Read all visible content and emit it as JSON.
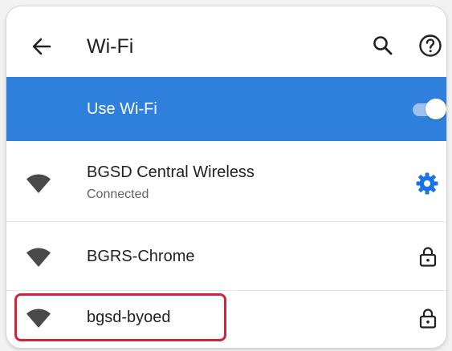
{
  "app_bar": {
    "title": "Wi-Fi",
    "icons": {
      "back": "arrow-back-icon",
      "search": "search-icon",
      "help": "help-circle-icon"
    }
  },
  "master_toggle": {
    "label": "Use Wi-Fi",
    "state": "on"
  },
  "networks": [
    {
      "ssid": "BGSD Central Wireless",
      "status": "Connected",
      "icon": "wifi-signal-icon",
      "trailing": "gear-icon",
      "secured": false
    },
    {
      "ssid": "BGRS-Chrome",
      "icon": "wifi-signal-icon",
      "trailing": "lock-icon",
      "secured": true
    },
    {
      "ssid": "bgsd-byoed",
      "icon": "wifi-signal-icon",
      "trailing": "lock-icon",
      "secured": true,
      "highlighted": true
    }
  ],
  "colors": {
    "accent": "#2f80dc",
    "gear": "#1a73e8",
    "text": "#202124",
    "secondary_text": "#5f6368",
    "highlight": "#d0243b",
    "wifi_icon": "#4a4a4a"
  }
}
